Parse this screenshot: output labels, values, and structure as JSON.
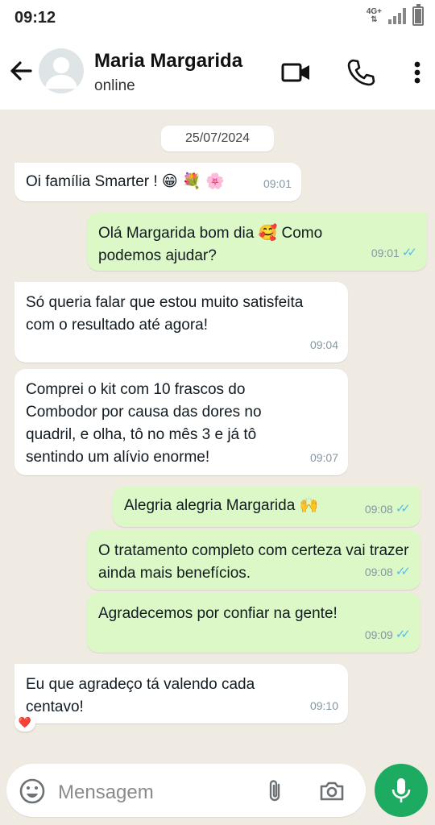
{
  "status_bar": {
    "time": "09:12",
    "network": "4G+"
  },
  "header": {
    "contact_name": "Maria Margarida",
    "contact_status": "online"
  },
  "chat": {
    "date": "25/07/2024",
    "messages": [
      {
        "dir": "in",
        "text": "Oi família Smarter ! 😁 💐 🌸",
        "time": "09:01"
      },
      {
        "dir": "out",
        "text": "Olá Margarida bom dia 🥰 Como podemos ajudar?",
        "time": "09:01"
      },
      {
        "dir": "in",
        "text": "Só queria falar que estou muito satisfeita com o resultado até agora!",
        "time": "09:04"
      },
      {
        "dir": "in",
        "text": "Comprei o kit com 10 frascos do Combodor por causa das dores no quadril, e olha, tô no mês 3 e já tô sentindo um alívio enorme!",
        "time": "09:07"
      },
      {
        "dir": "out",
        "text": "Alegria alegria Margarida 🙌",
        "time": "09:08"
      },
      {
        "dir": "out",
        "text": "O tratamento completo com certeza vai trazer ainda mais benefícios.",
        "time": "09:08"
      },
      {
        "dir": "out",
        "text": "Agradecemos por confiar na gente!",
        "time": "09:09"
      },
      {
        "dir": "in",
        "text": "Eu que agradeço tá valendo cada centavo!",
        "time": "09:10",
        "reaction": "❤️"
      }
    ]
  },
  "composer": {
    "placeholder": "Mensagem"
  },
  "colors": {
    "accent": "#1dab61",
    "outgoing": "#dcf8c6",
    "incoming": "#ffffff",
    "tick": "#53bdeb"
  }
}
